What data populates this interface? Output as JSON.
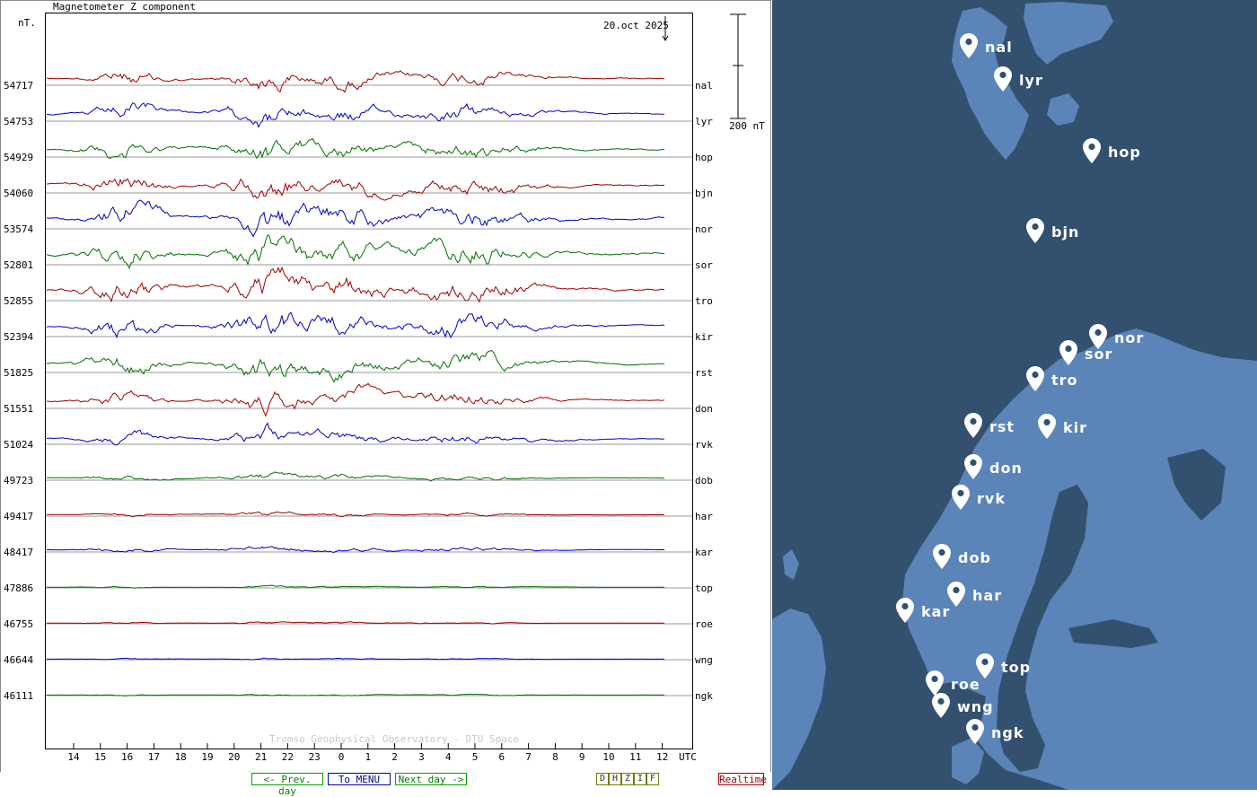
{
  "chart_data": {
    "type": "line",
    "title": "Magnetometer Z component",
    "y_unit_label": "nT.",
    "date_label": "20.oct 2025",
    "scale_bar_label": "200 nT",
    "x_unit_label": "UTC",
    "x_ticks": [
      "14",
      "15",
      "16",
      "17",
      "18",
      "19",
      "20",
      "21",
      "22",
      "23",
      "0",
      "1",
      "2",
      "3",
      "4",
      "5",
      "6",
      "7",
      "8",
      "9",
      "10",
      "11",
      "12"
    ],
    "credit": "Tromso Geophysical Observatory - DTU Space",
    "grid": true,
    "series": [
      {
        "name": "nal",
        "baseline": "54717",
        "color": "#a00000",
        "activity": 1.0
      },
      {
        "name": "lyr",
        "baseline": "54753",
        "color": "#0000c0",
        "activity": 1.0
      },
      {
        "name": "hop",
        "baseline": "54929",
        "color": "#007000",
        "activity": 1.1
      },
      {
        "name": "bjn",
        "baseline": "54060",
        "color": "#a00000",
        "activity": 1.2
      },
      {
        "name": "nor",
        "baseline": "53574",
        "color": "#0000c0",
        "activity": 1.5
      },
      {
        "name": "sor",
        "baseline": "52801",
        "color": "#007000",
        "activity": 1.5
      },
      {
        "name": "tro",
        "baseline": "52855",
        "color": "#a00000",
        "activity": 1.5
      },
      {
        "name": "kir",
        "baseline": "52394",
        "color": "#0000c0",
        "activity": 1.4
      },
      {
        "name": "rst",
        "baseline": "51825",
        "color": "#007000",
        "activity": 1.2
      },
      {
        "name": "don",
        "baseline": "51551",
        "color": "#a00000",
        "activity": 1.0
      },
      {
        "name": "rvk",
        "baseline": "51024",
        "color": "#0000c0",
        "activity": 0.8
      },
      {
        "name": "dob",
        "baseline": "49723",
        "color": "#007000",
        "activity": 0.35
      },
      {
        "name": "har",
        "baseline": "49417",
        "color": "#a00000",
        "activity": 0.2
      },
      {
        "name": "kar",
        "baseline": "48417",
        "color": "#0000c0",
        "activity": 0.3
      },
      {
        "name": "top",
        "baseline": "47886",
        "color": "#007000",
        "activity": 0.1
      },
      {
        "name": "roe",
        "baseline": "46755",
        "color": "#a00000",
        "activity": 0.1
      },
      {
        "name": "wng",
        "baseline": "46644",
        "color": "#0000c0",
        "activity": 0.08
      },
      {
        "name": "ngk",
        "baseline": "46111",
        "color": "#007000",
        "activity": 0.08
      }
    ]
  },
  "nav": {
    "prev": "<- Prev. day",
    "menu": "To MENU",
    "next": "Next day ->",
    "components": [
      "D",
      "H",
      "Z",
      "I",
      "F"
    ],
    "realtime": "Realtime"
  },
  "map": {
    "stations": [
      "nal",
      "lyr",
      "hop",
      "bjn",
      "nor",
      "sor",
      "tro",
      "rst",
      "kir",
      "don",
      "rvk",
      "dob",
      "har",
      "kar",
      "top",
      "roe",
      "wng",
      "ngk"
    ]
  },
  "colors": {
    "red": "#a00000",
    "blue": "#0000c0",
    "green": "#007000",
    "map_sea": "#34506f",
    "map_land": "#5b84b8"
  }
}
